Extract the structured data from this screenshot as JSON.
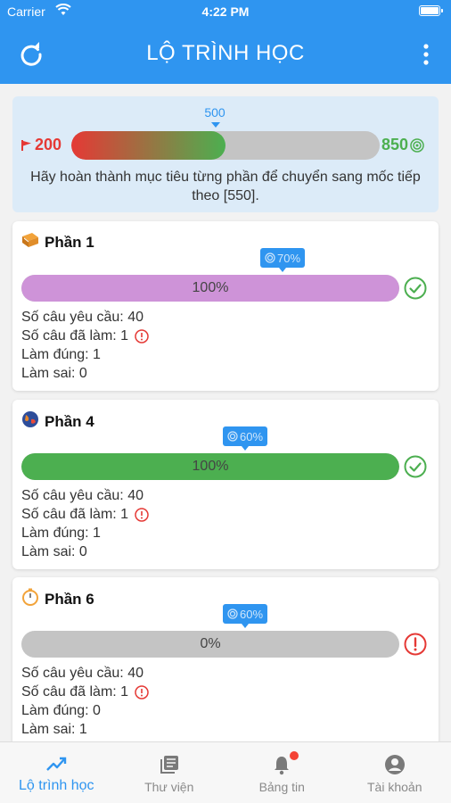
{
  "status_bar": {
    "carrier": "Carrier",
    "time": "4:22 PM"
  },
  "app_bar": {
    "title": "LỘ TRÌNH HỌC"
  },
  "milestone": {
    "current_value": "500",
    "start_value": "200",
    "end_value": "850",
    "progress_fraction": 0.5,
    "message": "Hãy hoàn thành mục tiêu từng phần để chuyển sang mốc tiếp theo [550]."
  },
  "parts": [
    {
      "title": "Phần 1",
      "target": "70%",
      "progress_text": "100%",
      "progress_fraction": 1.0,
      "bar_color": "#ce93d8",
      "status": "complete",
      "required": "Số câu yêu cầu: 40",
      "done": "Số câu đã làm: 1",
      "correct": "Làm đúng: 1",
      "wrong": "Làm sai: 0"
    },
    {
      "title": "Phần 4",
      "target": "60%",
      "progress_text": "100%",
      "progress_fraction": 1.0,
      "bar_color": "#4caf50",
      "status": "complete",
      "required": "Số câu yêu cầu: 40",
      "done": "Số câu đã làm: 1",
      "correct": "Làm đúng: 1",
      "wrong": "Làm sai: 0"
    },
    {
      "title": "Phần 6",
      "target": "60%",
      "progress_text": "0%",
      "progress_fraction": 0.0,
      "bar_color": "#c4c4c4",
      "status": "incomplete",
      "required": "Số câu yêu cầu: 40",
      "done": "Số câu đã làm: 1",
      "correct": "Làm đúng: 0",
      "wrong": "Làm sai: 1"
    }
  ],
  "tabs": [
    {
      "label": "Lộ trình học",
      "icon": "trending-up-icon",
      "active": true
    },
    {
      "label": "Thư viện",
      "icon": "library-icon",
      "active": false
    },
    {
      "label": "Bảng tin",
      "icon": "bell-icon",
      "active": false,
      "badge": true
    },
    {
      "label": "Tài khoản",
      "icon": "account-icon",
      "active": false
    }
  ],
  "colors": {
    "primary": "#2f95f0",
    "success": "#4caf50",
    "error": "#e53935",
    "muted": "#c4c4c4"
  }
}
